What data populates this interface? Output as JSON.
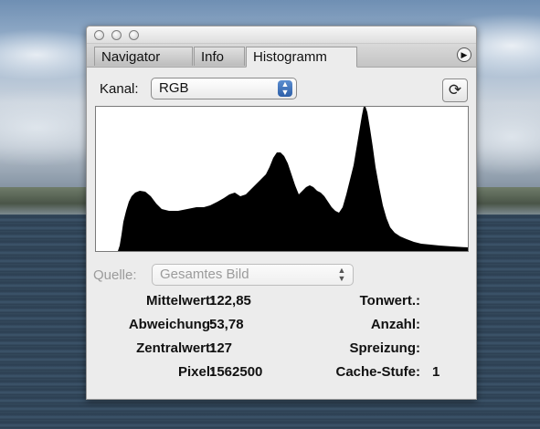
{
  "tabs": [
    {
      "label": "Navigator",
      "active": false
    },
    {
      "label": "Info",
      "active": false
    },
    {
      "label": "Histogramm",
      "active": true
    }
  ],
  "kanal": {
    "label": "Kanal:",
    "value": "RGB"
  },
  "quelle": {
    "label": "Quelle:",
    "value": "Gesamtes Bild",
    "disabled": true
  },
  "stats_left": [
    {
      "label": "Mittelwert:",
      "value": "122,85"
    },
    {
      "label": "Abweichung:",
      "value": "53,78"
    },
    {
      "label": "Zentralwert:",
      "value": "127"
    },
    {
      "label": "Pixel:",
      "value": "1562500"
    }
  ],
  "stats_right": [
    {
      "label": "Tonwert.:",
      "value": ""
    },
    {
      "label": "Anzahl:",
      "value": ""
    },
    {
      "label": "Spreizung:",
      "value": ""
    },
    {
      "label": "Cache-Stufe:",
      "value": "1"
    }
  ],
  "icons": {
    "close": "close-button-icon",
    "minimize": "minimize-button-icon",
    "zoom": "zoom-button-icon",
    "menu": "panel-menu-icon",
    "refresh": "refresh-icon",
    "select_arrows": "up-down-arrows-icon"
  },
  "histogram_color": "#000000"
}
